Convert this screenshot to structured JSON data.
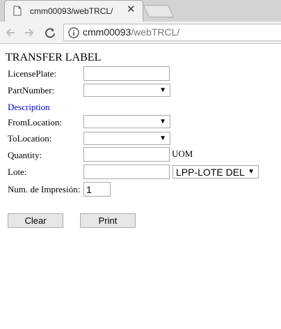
{
  "browser": {
    "tab_title": "cmm00093/webTRCL/",
    "tab_close": "✕",
    "url_host": "cmm00093",
    "url_path": "/webTRCL/"
  },
  "form": {
    "title": "TRANSFER LABEL",
    "license_plate": {
      "label": "LicensePlate:",
      "value": ""
    },
    "part_number": {
      "label": "PartNumber:",
      "value": ""
    },
    "description_label": "Description",
    "from_location": {
      "label": "FromLocation:",
      "value": ""
    },
    "to_location": {
      "label": "ToLocation:",
      "value": ""
    },
    "quantity": {
      "label": "Quantity:",
      "value": "",
      "unit_label": "UOM"
    },
    "lote": {
      "label": "Lote:",
      "value": "",
      "option_selected": "LPP-LOTE DEL PROVEEDOR"
    },
    "print_count": {
      "label": "Num. de Impresión:",
      "value": "1"
    },
    "buttons": {
      "clear": "Clear",
      "print": "Print"
    },
    "dropdown_arrow": "▼"
  }
}
